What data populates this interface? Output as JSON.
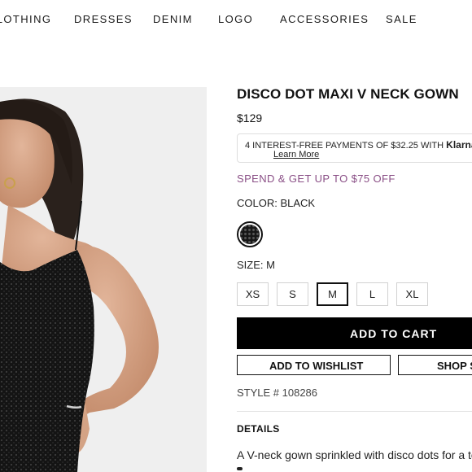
{
  "nav": {
    "items": [
      "CLOTHING",
      "DRESSES",
      "DENIM",
      "LOGO",
      "ACCESSORIES",
      "SALE"
    ]
  },
  "product": {
    "title": "DISCO DOT MAXI V NECK GOWN",
    "price": "$129",
    "klarna": {
      "text": "4 INTEREST-FREE PAYMENTS OF $32.25 WITH",
      "brand": "Klarna.",
      "link": "Learn More"
    },
    "promo": "SPEND & GET UP TO $75 OFF",
    "color_label": "COLOR: BLACK",
    "swatch_color": "#161616",
    "size_label": "SIZE: M",
    "sizes": [
      "XS",
      "S",
      "M",
      "L",
      "XL"
    ],
    "selected_size": "M",
    "add_to_cart": "ADD TO CART",
    "add_to_wishlist": "ADD TO WISHLIST",
    "shop_similar": "SHOP SIMILAR",
    "style_no": "STYLE # 108286",
    "details_title": "DETAILS",
    "details_text": "A V-neck gown sprinkled with disco dots for a touch of sparkle"
  },
  "colors": {
    "accent_promo": "#8a4f86",
    "button_bg": "#000000",
    "image_bg": "#efefef"
  }
}
